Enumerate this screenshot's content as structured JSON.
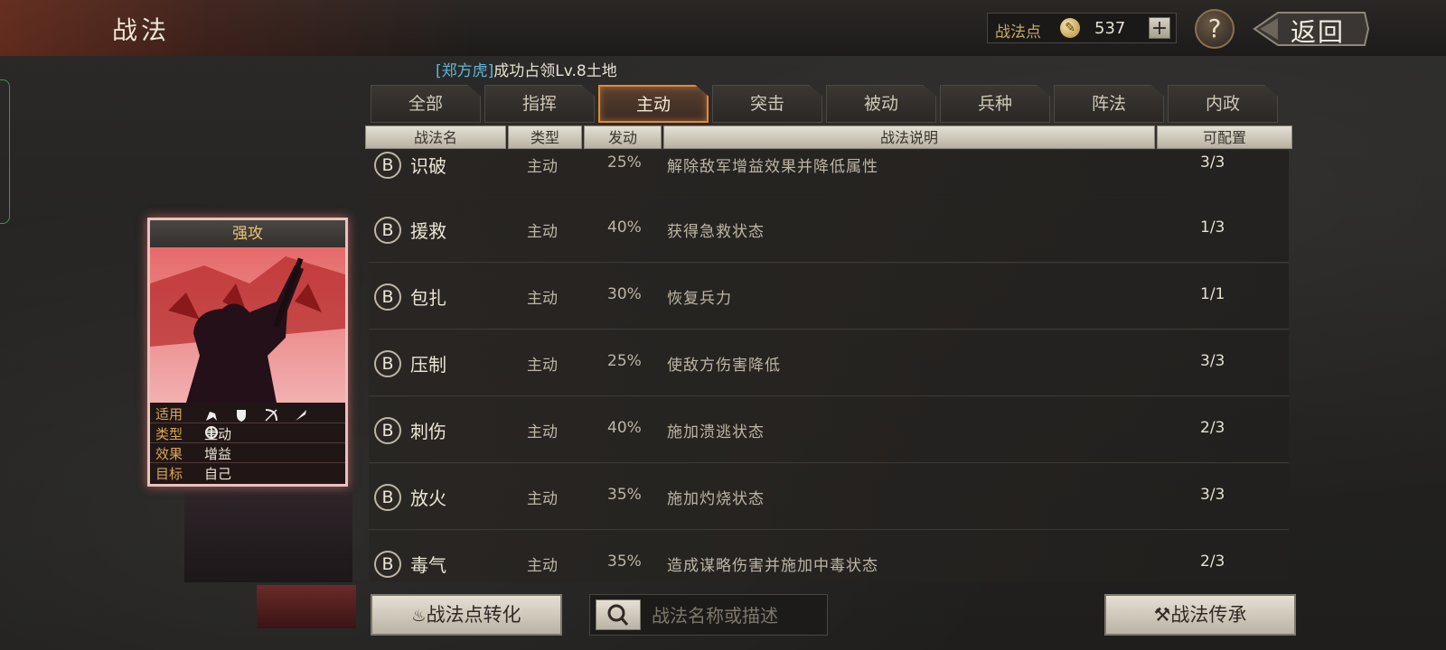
{
  "header": {
    "title": "战法",
    "points_label": "战法点",
    "points_value": "537",
    "plus_label": "+",
    "help_label": "?",
    "back_label": "返回"
  },
  "notice": {
    "player": "[郑方虎]",
    "message": "成功占领Lv.8土地"
  },
  "tabs": [
    {
      "label": "全部",
      "active": false
    },
    {
      "label": "指挥",
      "active": false
    },
    {
      "label": "主动",
      "active": true
    },
    {
      "label": "突击",
      "active": false
    },
    {
      "label": "被动",
      "active": false
    },
    {
      "label": "兵种",
      "active": false
    },
    {
      "label": "阵法",
      "active": false
    },
    {
      "label": "内政",
      "active": false
    }
  ],
  "table": {
    "columns": [
      "战法名",
      "类型",
      "发动",
      "战法说明",
      "可配置"
    ],
    "rows": [
      {
        "grade": "B",
        "name": "识破",
        "type": "主动",
        "rate": "25%",
        "desc": "解除敌军增益效果并降低属性",
        "slots": "3/3"
      },
      {
        "grade": "B",
        "name": "援救",
        "type": "主动",
        "rate": "40%",
        "desc": "获得急救状态",
        "slots": "1/3"
      },
      {
        "grade": "B",
        "name": "包扎",
        "type": "主动",
        "rate": "30%",
        "desc": "恢复兵力",
        "slots": "1/1"
      },
      {
        "grade": "B",
        "name": "压制",
        "type": "主动",
        "rate": "25%",
        "desc": "使敌方伤害降低",
        "slots": "3/3"
      },
      {
        "grade": "B",
        "name": "刺伤",
        "type": "主动",
        "rate": "40%",
        "desc": "施加溃逃状态",
        "slots": "2/3"
      },
      {
        "grade": "B",
        "name": "放火",
        "type": "主动",
        "rate": "35%",
        "desc": "施加灼烧状态",
        "slots": "3/3"
      },
      {
        "grade": "B",
        "name": "毒气",
        "type": "主动",
        "rate": "35%",
        "desc": "造成谋略伤害并施加中毒状态",
        "slots": "2/3"
      }
    ]
  },
  "card": {
    "title": "强攻",
    "apply_label": "适用",
    "apply_icons": [
      "cavalry-icon",
      "shield-icon",
      "bow-icon",
      "spear-icon",
      "wheel-icon"
    ],
    "type_label": "类型",
    "type_value": "主动",
    "effect_label": "效果",
    "effect_value": "增益",
    "target_label": "目标",
    "target_value": "自己"
  },
  "bottom": {
    "convert_button": "战法点转化",
    "search_placeholder": "战法名称或描述",
    "inherit_button": "战法传承"
  },
  "colors": {
    "accent_orange": "#e08a3a",
    "notice_name": "#5fb6d6",
    "card_border": "#e7c3bd",
    "label_gold": "#d9a755"
  }
}
